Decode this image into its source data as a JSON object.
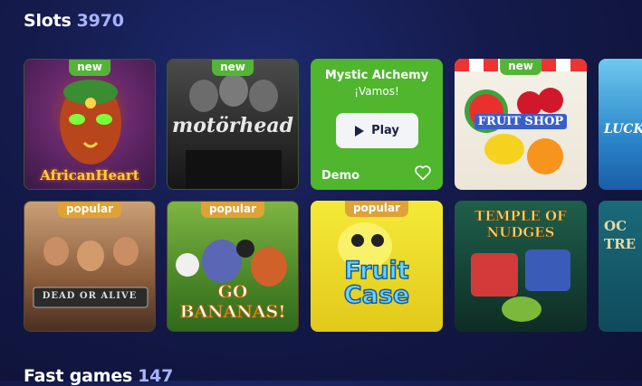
{
  "sections": {
    "slots": {
      "title": "Slots",
      "count": "3970"
    },
    "fast_games": {
      "title": "Fast games",
      "count": "147"
    }
  },
  "cards": [
    {
      "badge": "new",
      "art_text": "AfricanHeart"
    },
    {
      "badge": "new",
      "art_text": "motörhead"
    },
    {
      "title": "Mystic Alchemy",
      "subtitle": "¡Vamos!",
      "play_label": "Play",
      "demo_label": "Demo"
    },
    {
      "badge": "new",
      "art_text": "FRUIT SHOP"
    },
    {
      "art_text": "LUCK"
    },
    {
      "badge": "popular",
      "art_text": "DEAD OR ALIVE"
    },
    {
      "badge": "popular",
      "art_text": "GO BANANAS!"
    },
    {
      "badge": "popular",
      "art_text": "Fruit Case"
    },
    {
      "art_text": "TEMPLE OF NUDGES"
    },
    {
      "art_text": "OC TRE"
    }
  ],
  "colors": {
    "accent_green": "#4fb62e",
    "badge_new": "#54b437",
    "badge_popular": "#dfa236",
    "count_color": "#a9b2ff"
  },
  "icons": {
    "play": "play-icon",
    "favorite": "heart-outline-icon"
  }
}
